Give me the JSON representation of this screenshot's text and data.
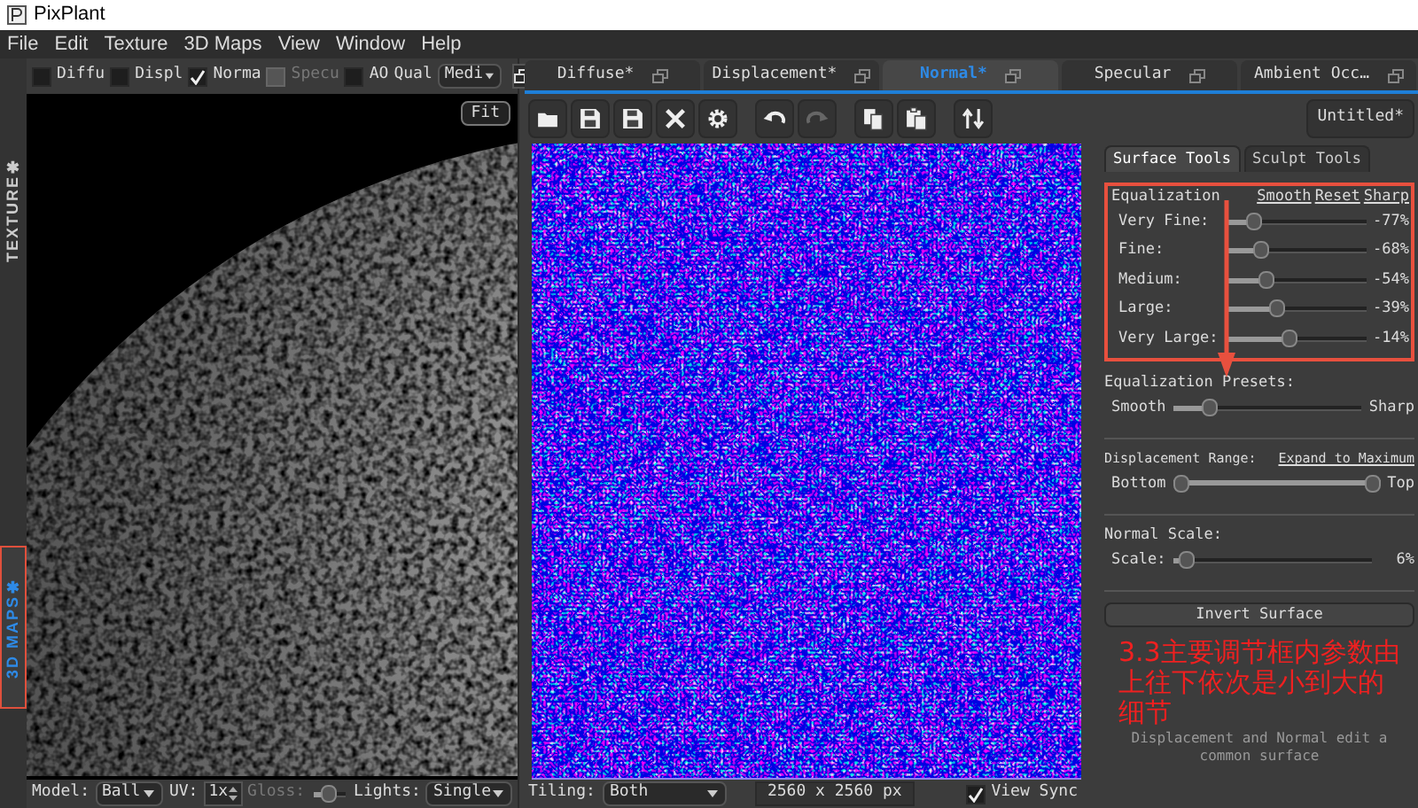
{
  "window": {
    "title": "PixPlant"
  },
  "menu": [
    "File",
    "Edit",
    "Texture",
    "3D Maps",
    "View",
    "Window",
    "Help"
  ],
  "side_tabs": [
    {
      "label": "TEXTURE✱",
      "selected": false
    },
    {
      "label": "3D MAPS✱",
      "selected": true
    }
  ],
  "preview_toolbar": {
    "checkboxes": [
      {
        "label": "Diffu",
        "checked": false,
        "disabled": false
      },
      {
        "label": "Displ",
        "checked": false,
        "disabled": false
      },
      {
        "label": "Norma",
        "checked": true,
        "disabled": false
      },
      {
        "label": "Specu",
        "checked": false,
        "disabled": true
      },
      {
        "label": "AO",
        "checked": false,
        "disabled": false
      }
    ],
    "quality_label": "Qual",
    "quality_value": "Medi"
  },
  "fit_button": "Fit",
  "preview_bottom": {
    "model_label": "Model:",
    "model_value": "Ball",
    "uv_label": "UV:",
    "uv_value": "1x",
    "gloss_label": "Gloss:",
    "gloss": {
      "level": 0.5
    },
    "lights_label": "Lights:",
    "lights_value": "Single"
  },
  "map_tabs": [
    {
      "label": "Diffuse*",
      "selected": false
    },
    {
      "label": "Displacement*",
      "selected": false
    },
    {
      "label": "Normal*",
      "selected": true
    },
    {
      "label": "Specular",
      "selected": false
    },
    {
      "label": "Ambient Occ…",
      "selected": false
    }
  ],
  "document_button": "Untitled*",
  "texture_bottom": {
    "tiling_label": "Tiling:",
    "tiling_value": "Both",
    "size": "2560 x 2560 px",
    "view_sync": {
      "label": "View Sync",
      "checked": true
    }
  },
  "tool_tabs": [
    {
      "label": "Surface Tools",
      "selected": true
    },
    {
      "label": "Sculpt Tools",
      "selected": false
    }
  ],
  "equalization": {
    "title": "Equalization",
    "links": [
      "Smooth",
      "Reset",
      "Sharp"
    ],
    "sliders": [
      {
        "label": "Very Fine:",
        "level": 0.14,
        "reading": "-77%"
      },
      {
        "label": "Fine:",
        "level": 0.2,
        "reading": "-68%"
      },
      {
        "label": "Medium:",
        "level": 0.25,
        "reading": "-54%"
      },
      {
        "label": "Large:",
        "level": 0.33,
        "reading": "-39%"
      },
      {
        "label": "Very Large:",
        "level": 0.44,
        "reading": "-14%"
      }
    ]
  },
  "presets": {
    "title": "Equalization Presets:",
    "left": "Smooth",
    "right": "Sharp",
    "level": 0.17
  },
  "displacement_range": {
    "title": "Displacement Range:",
    "link": "Expand to Maximum",
    "left": "Bottom",
    "right": "Top",
    "handles": [
      {
        "level": 0
      },
      {
        "level": 1
      }
    ]
  },
  "normal_scale": {
    "title": "Normal Scale:",
    "label": "Scale:",
    "level": 0.03,
    "reading": "6%"
  },
  "invert_button": "Invert Surface",
  "annotation": "3.3主要调节框内参数由上往下依次是小到大的细节",
  "footer_note": "Displacement and Normal edit a common surface"
}
